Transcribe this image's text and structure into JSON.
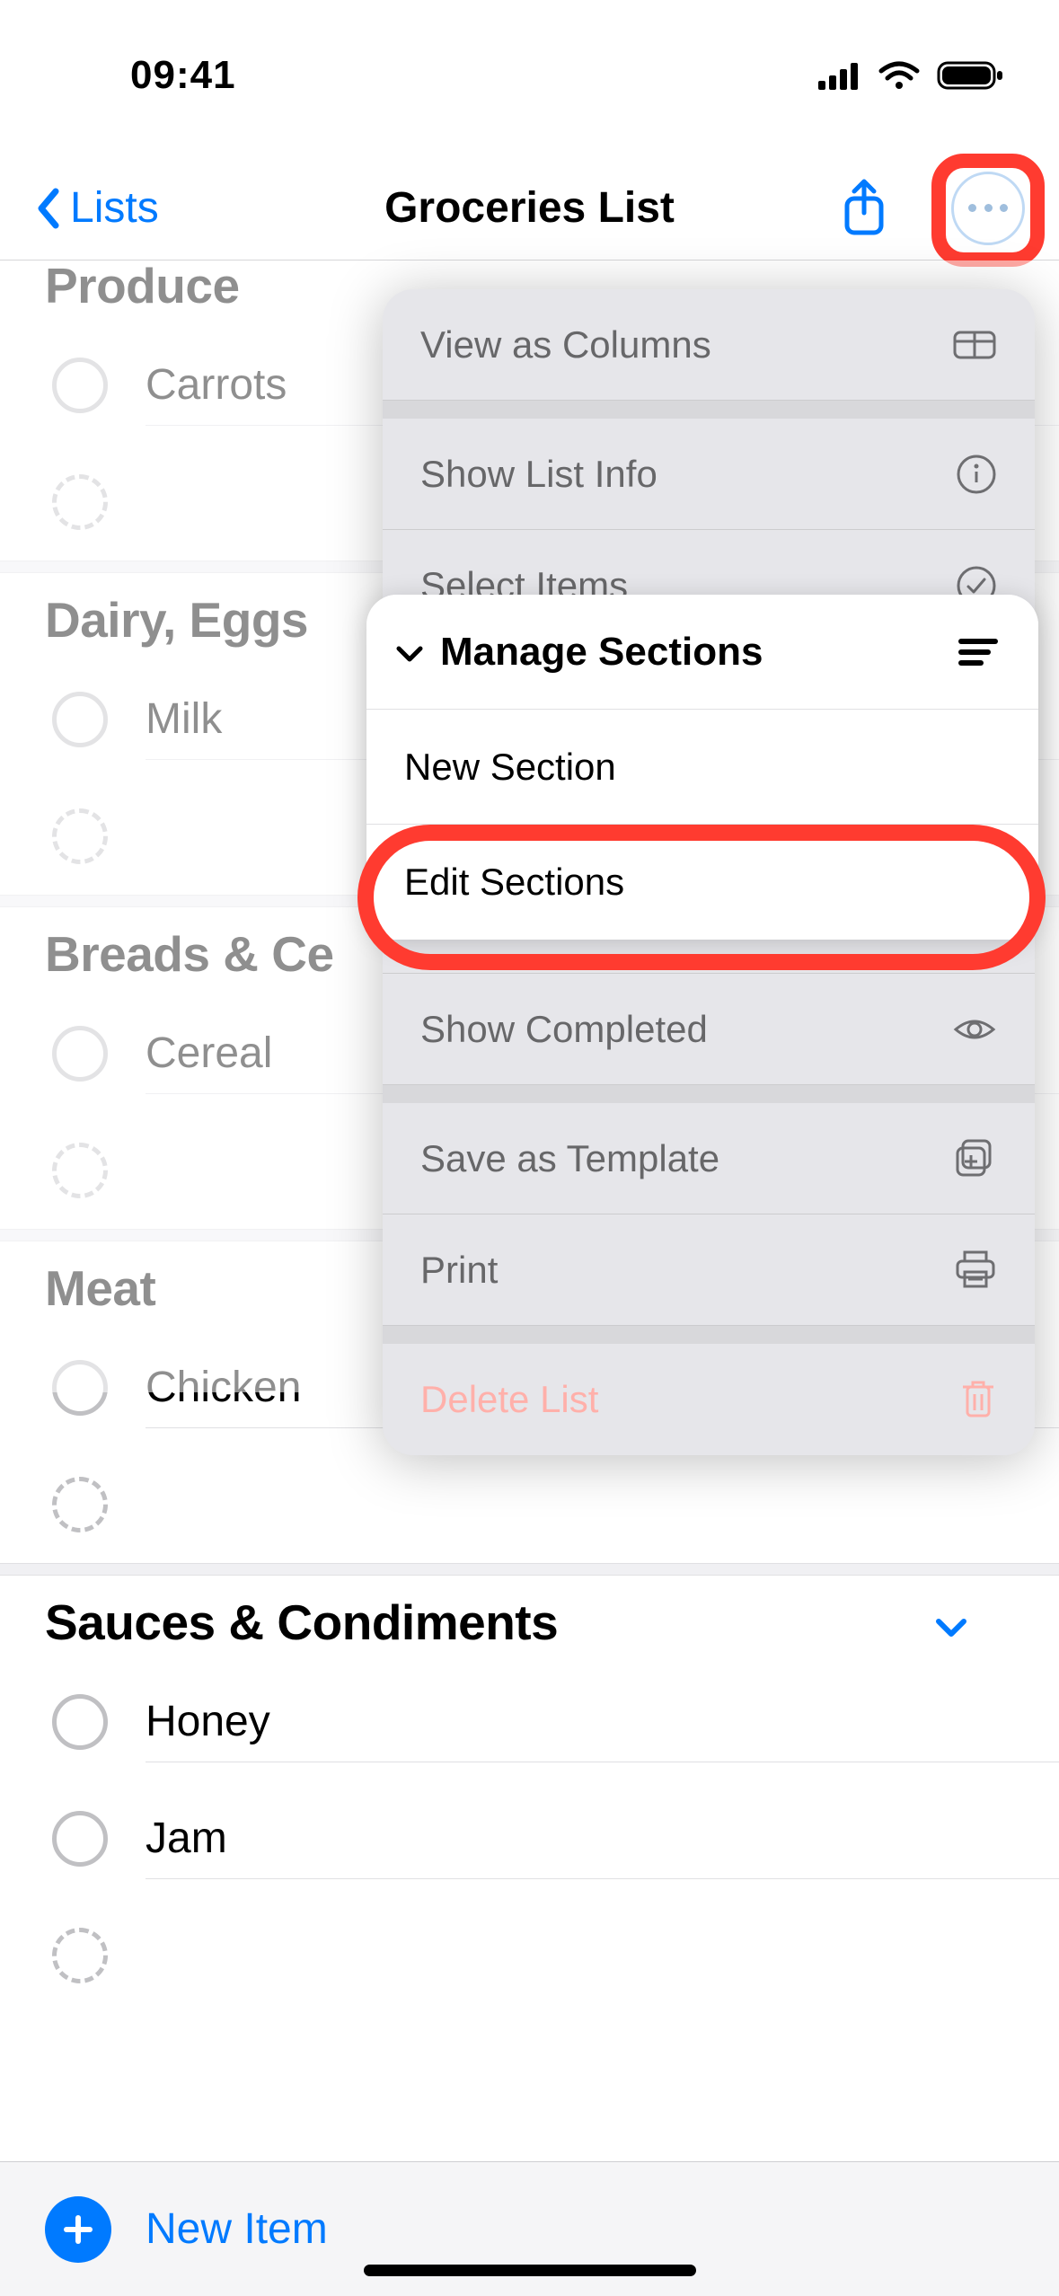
{
  "status": {
    "time": "09:41"
  },
  "nav": {
    "back_label": "Lists",
    "title": "Groceries List"
  },
  "sections": [
    {
      "name": "Produce",
      "truncated": true,
      "items": [
        "Carrots"
      ]
    },
    {
      "name": "Dairy, Eggs",
      "truncated": true,
      "items": [
        "Milk"
      ]
    },
    {
      "name": "Breads & Ce",
      "truncated": true,
      "items": [
        "Cereal"
      ]
    },
    {
      "name": "Meat",
      "truncated": false,
      "items": [
        "Chicken"
      ]
    },
    {
      "name": "Sauces & Condiments",
      "truncated": false,
      "items": [
        "Honey",
        "Jam"
      ]
    }
  ],
  "menu": {
    "view_as_columns": "View as Columns",
    "show_list_info": "Show List Info",
    "select_items": "Select Items",
    "manage_sections": "Manage Sections",
    "new_section": "New Section",
    "edit_sections": "Edit Sections",
    "show_completed": "Show Completed",
    "save_as_template": "Save as Template",
    "print": "Print",
    "delete_list": "Delete List"
  },
  "bottom": {
    "new_item": "New Item"
  }
}
